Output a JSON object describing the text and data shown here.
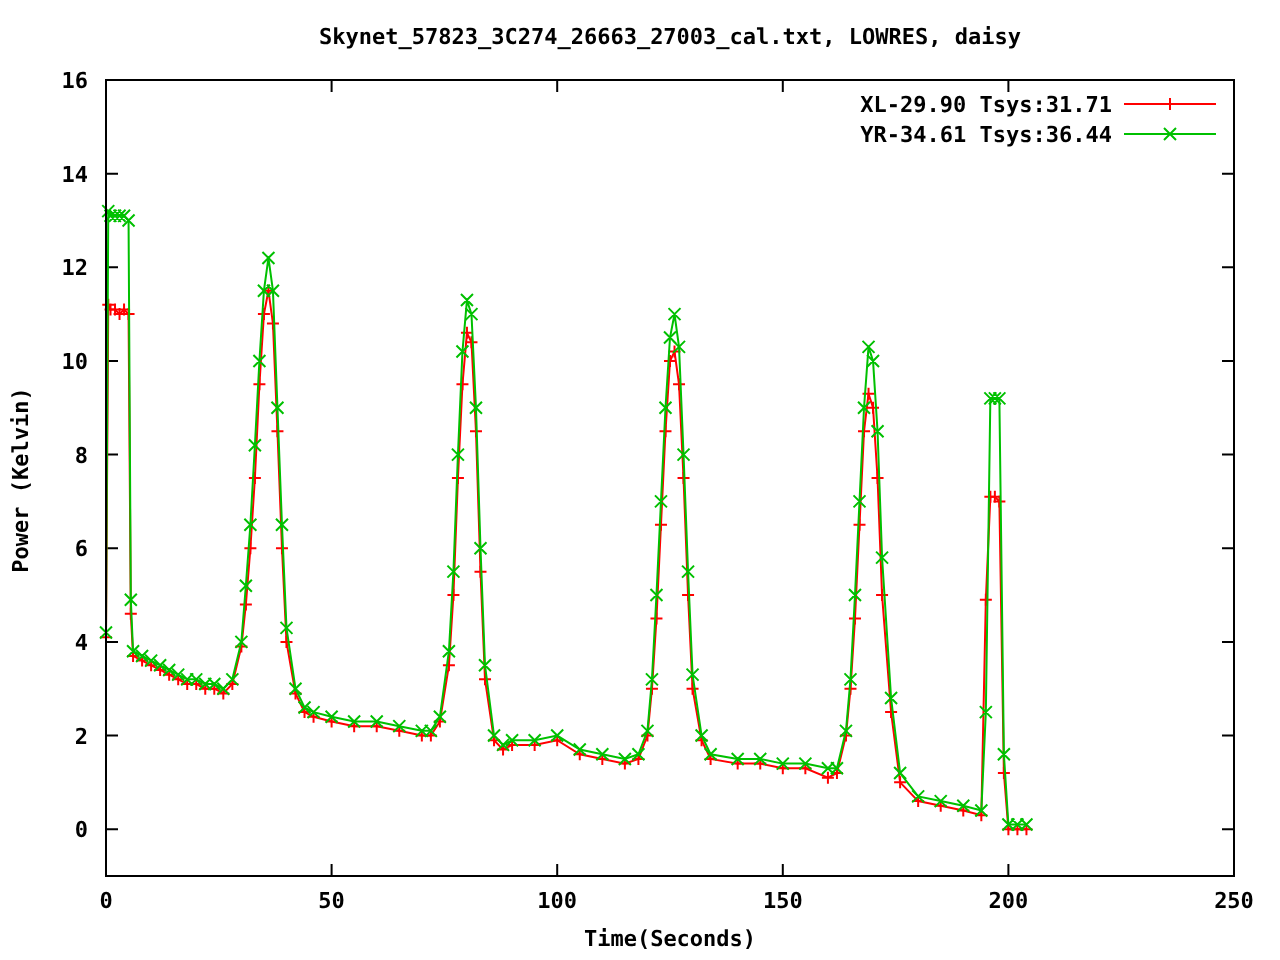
{
  "chart_data": {
    "type": "line",
    "title": "Skynet_57823_3C274_26663_27003_cal.txt, LOWRES, daisy",
    "xlabel": "Time(Seconds)",
    "ylabel": "Power (Kelvin)",
    "xlim": [
      0,
      250
    ],
    "ylim": [
      -1,
      16
    ],
    "xticks": [
      0,
      50,
      100,
      150,
      200,
      250
    ],
    "yticks": [
      0,
      2,
      4,
      6,
      8,
      10,
      12,
      14,
      16
    ],
    "legend": true,
    "x": [
      0,
      0.5,
      1,
      2,
      3,
      4,
      5,
      5.5,
      6,
      8,
      10,
      12,
      14,
      16,
      18,
      20,
      22,
      24,
      26,
      28,
      30,
      31,
      32,
      33,
      34,
      35,
      36,
      37,
      38,
      39,
      40,
      42,
      44,
      46,
      50,
      55,
      60,
      65,
      70,
      72,
      74,
      76,
      77,
      78,
      79,
      80,
      81,
      82,
      83,
      84,
      86,
      88,
      90,
      95,
      100,
      105,
      110,
      115,
      118,
      120,
      121,
      122,
      123,
      124,
      125,
      126,
      127,
      128,
      129,
      130,
      132,
      134,
      140,
      145,
      150,
      155,
      160,
      162,
      164,
      165,
      166,
      167,
      168,
      169,
      170,
      171,
      172,
      174,
      176,
      180,
      185,
      190,
      194,
      195,
      196,
      197,
      198,
      199,
      200,
      202,
      204
    ],
    "series": [
      {
        "name": "XL-29.90 Tsys:31.71",
        "color": "#ff0000",
        "marker": "plus",
        "values": [
          4.1,
          11.2,
          11.1,
          11.1,
          11.0,
          11.1,
          11.0,
          4.6,
          3.7,
          3.6,
          3.5,
          3.4,
          3.3,
          3.2,
          3.1,
          3.1,
          3.0,
          3.0,
          2.9,
          3.1,
          3.9,
          4.8,
          6.0,
          7.5,
          9.5,
          11.0,
          11.5,
          10.8,
          8.5,
          6.0,
          4.0,
          2.9,
          2.5,
          2.4,
          2.3,
          2.2,
          2.2,
          2.1,
          2.0,
          2.0,
          2.3,
          3.5,
          5.0,
          7.5,
          9.5,
          10.6,
          10.4,
          8.5,
          5.5,
          3.2,
          1.9,
          1.7,
          1.8,
          1.8,
          1.9,
          1.6,
          1.5,
          1.4,
          1.5,
          2.0,
          3.0,
          4.5,
          6.5,
          8.5,
          10.0,
          10.2,
          9.5,
          7.5,
          5.0,
          3.0,
          1.9,
          1.5,
          1.4,
          1.4,
          1.3,
          1.3,
          1.1,
          1.2,
          2.0,
          3.0,
          4.5,
          6.5,
          8.5,
          9.3,
          9.0,
          7.5,
          5.0,
          2.5,
          1.0,
          0.6,
          0.5,
          0.4,
          0.3,
          4.9,
          7.1,
          7.1,
          7.0,
          1.2,
          0.0,
          0.0,
          0.0
        ]
      },
      {
        "name": "YR-34.61 Tsys:36.44",
        "color": "#00c000",
        "marker": "cross",
        "values": [
          4.2,
          13.2,
          13.1,
          13.1,
          13.1,
          13.1,
          13.0,
          4.9,
          3.8,
          3.7,
          3.6,
          3.5,
          3.4,
          3.3,
          3.2,
          3.2,
          3.1,
          3.1,
          3.0,
          3.2,
          4.0,
          5.2,
          6.5,
          8.2,
          10.0,
          11.5,
          12.2,
          11.5,
          9.0,
          6.5,
          4.3,
          3.0,
          2.6,
          2.5,
          2.4,
          2.3,
          2.3,
          2.2,
          2.1,
          2.1,
          2.4,
          3.8,
          5.5,
          8.0,
          10.2,
          11.3,
          11.0,
          9.0,
          6.0,
          3.5,
          2.0,
          1.8,
          1.9,
          1.9,
          2.0,
          1.7,
          1.6,
          1.5,
          1.6,
          2.1,
          3.2,
          5.0,
          7.0,
          9.0,
          10.5,
          11.0,
          10.3,
          8.0,
          5.5,
          3.3,
          2.0,
          1.6,
          1.5,
          1.5,
          1.4,
          1.4,
          1.3,
          1.3,
          2.1,
          3.2,
          5.0,
          7.0,
          9.0,
          10.3,
          10.0,
          8.5,
          5.8,
          2.8,
          1.2,
          0.7,
          0.6,
          0.5,
          0.4,
          2.5,
          9.2,
          9.2,
          9.2,
          1.6,
          0.1,
          0.1,
          0.1
        ]
      }
    ]
  }
}
